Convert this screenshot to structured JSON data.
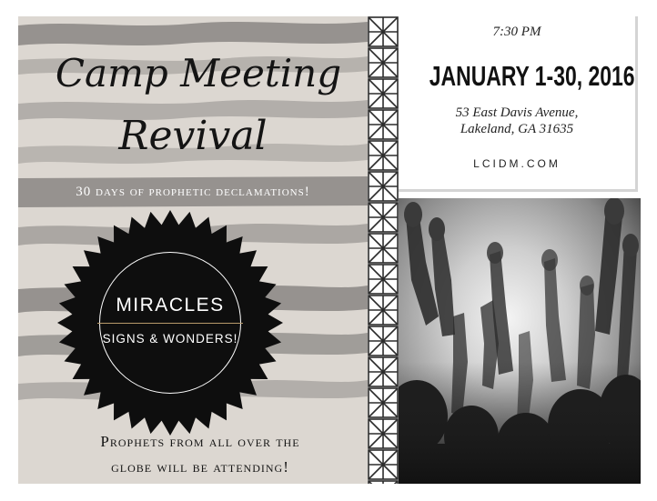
{
  "flyer": {
    "title_line1": "Camp Meeting",
    "title_line2": "Revival",
    "subtitle": "30 days of prophetic declamations!",
    "badge": {
      "main": "MIRACLES",
      "sub": "SIGNS & WONDERS!"
    },
    "footer_line1": "Prophets from all over the",
    "footer_line2": "globe will be attending!"
  },
  "info": {
    "time": "7:30 PM",
    "dates": "JANUARY 1-30, 2016",
    "address_line1": "53 East Davis Avenue,",
    "address_line2": "Lakeland, GA 31635",
    "website": "LCIDM.COM"
  },
  "colors": {
    "background": "#ffffff",
    "panel": "#dcd7d1",
    "stripe": "#8a8784",
    "badge": "#0e0e0e",
    "accent_divider": "#b89a6a",
    "text_dark": "#141414"
  },
  "images": {
    "photo": "crowd-raised-hands-photo"
  }
}
